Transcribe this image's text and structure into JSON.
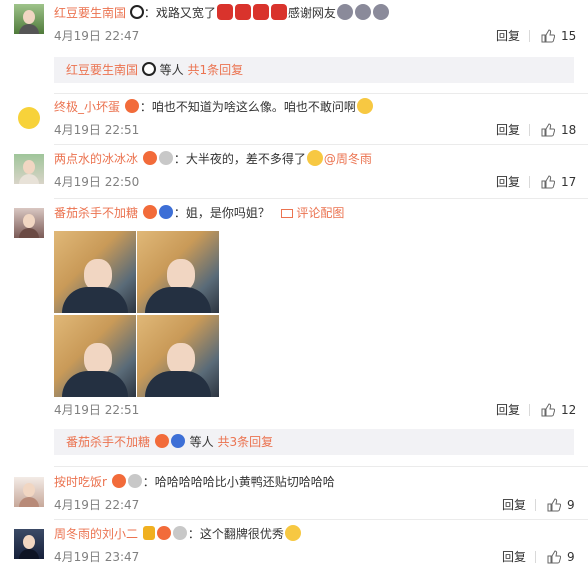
{
  "comments": [
    {
      "user": "红豆要生南国",
      "text": "：戏路又宽了",
      "text2": "感谢网友",
      "time": "4月19日 22:47",
      "reply": "回复",
      "likes": "15",
      "sub": {
        "user": "红豆要生南国",
        "suffix": "等人",
        "count": "共1条回复"
      }
    },
    {
      "user": "终极_小坏蛋",
      "text": "：咱也不知道为啥这么像。咱也不敢问啊",
      "time": "4月19日 22:51",
      "reply": "回复",
      "likes": "18"
    },
    {
      "user": "两点水的冰冰冰",
      "text": "：大半夜的，差不多得了",
      "mention": "@周冬雨",
      "time": "4月19日 22:50",
      "reply": "回复",
      "likes": "17"
    },
    {
      "user": "番茄杀手不加糖",
      "text": "：姐，是你吗姐？",
      "pic_link": "评论配图",
      "time": "4月19日 22:51",
      "reply": "回复",
      "likes": "12",
      "sub": {
        "user": "番茄杀手不加糖",
        "suffix": "等人",
        "count": "共3条回复"
      }
    },
    {
      "user": "按时吃饭r",
      "text": "：哈哈哈哈哈比小黄鸭还贴切哈哈哈",
      "time": "4月19日 22:47",
      "reply": "回复",
      "likes": "9"
    },
    {
      "user": "周冬雨的刘小二",
      "text": "：这个翻牌很优秀",
      "time": "4月19日 23:47",
      "reply": "回复",
      "likes": "9"
    }
  ],
  "icons": {
    "like": "thumbs-up-icon",
    "pic": "image-icon",
    "accent": "#eb7350"
  }
}
